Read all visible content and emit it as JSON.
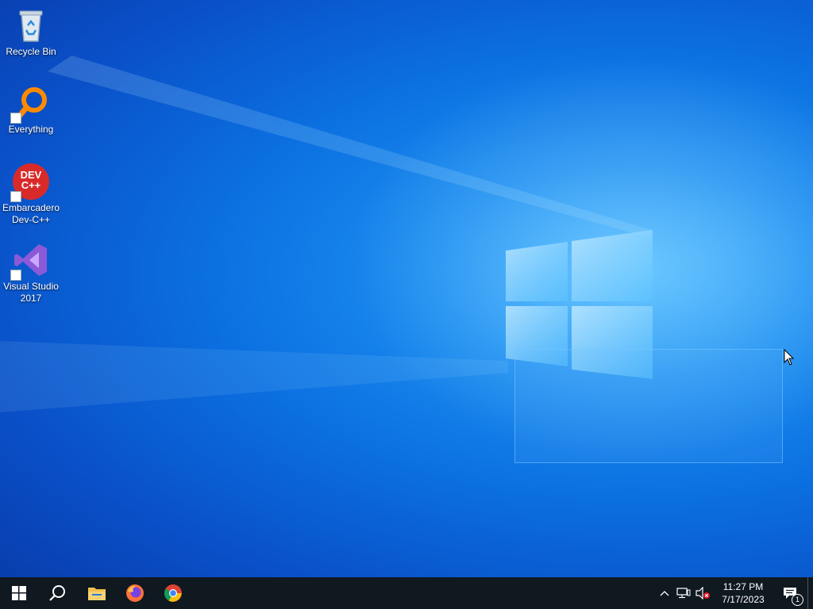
{
  "desktop": {
    "icons": [
      {
        "label": "Recycle Bin",
        "icon": "recycle-bin-icon"
      },
      {
        "label": "Everything",
        "icon": "everything-search-icon"
      },
      {
        "label": "Embarcadero Dev-C++",
        "icon": "devcpp-icon",
        "glyph_text": "DEV C++"
      },
      {
        "label": "Visual Studio 2017",
        "icon": "visual-studio-icon"
      }
    ]
  },
  "taskbar": {
    "start_icon": "windows-start-icon",
    "search_icon": "search-icon",
    "pinned": [
      {
        "name": "file-explorer",
        "icon": "folder-icon"
      },
      {
        "name": "firefox",
        "icon": "firefox-icon"
      },
      {
        "name": "chrome",
        "icon": "chrome-icon"
      }
    ],
    "tray": {
      "chevron_icon": "chevron-up-icon",
      "network_icon": "network-icon",
      "volume_icon": "volume-muted-icon",
      "time": "11:27 PM",
      "date": "7/17/2023",
      "notification_icon": "notification-icon",
      "notification_count": "1"
    }
  },
  "colors": {
    "taskbar_bg": "#101820",
    "wallpaper_accent": "#1b8cf0"
  }
}
